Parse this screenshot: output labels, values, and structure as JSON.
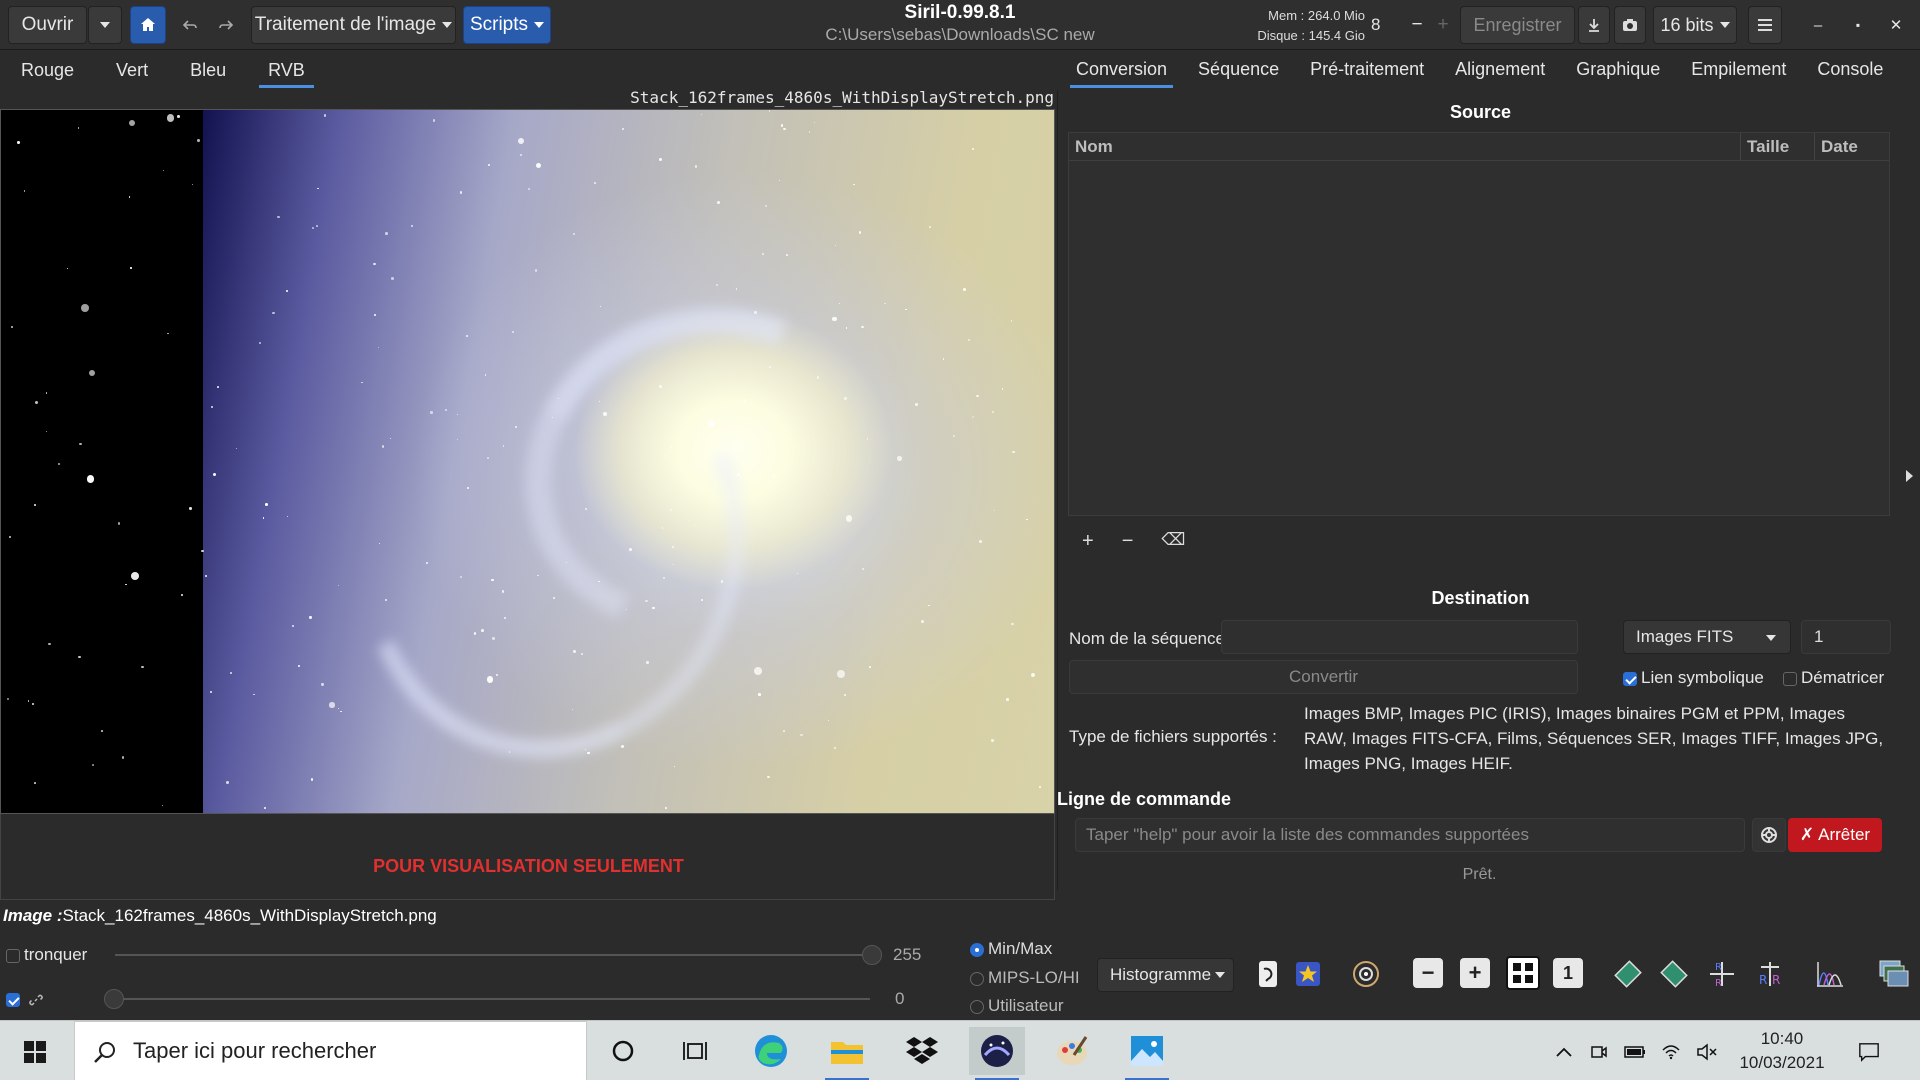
{
  "header": {
    "open_label": "Ouvrir",
    "processing_label": "Traitement de l'image",
    "scripts_label": "Scripts",
    "app_title": "Siril-0.99.8.1",
    "working_dir": "C:\\Users\\sebas\\Downloads\\SC new",
    "mem_label": "Mem : 264.0 Mio",
    "disk_label": "Disque : 145.4 Gio",
    "threads_value": "8",
    "minus_label": "−",
    "plus_label": "+",
    "save_label": "Enregistrer",
    "bitdepth_label": "16 bits",
    "minimize_label": "–",
    "maximize_label": "▪",
    "close_label": "✕"
  },
  "channel_tabs": [
    "Rouge",
    "Vert",
    "Bleu",
    "RVB"
  ],
  "active_channel": "RVB",
  "image": {
    "filename": "Stack_162frames_4860s_WithDisplayStretch.png",
    "preview_notice": "POUR VISUALISATION SEULEMENT"
  },
  "right_tabs": [
    "Conversion",
    "Séquence",
    "Pré-traitement",
    "Alignement",
    "Graphique",
    "Empilement",
    "Console"
  ],
  "active_right_tab": "Conversion",
  "conversion": {
    "source_title": "Source",
    "columns": [
      "Nom",
      "Taille",
      "Date"
    ],
    "add_label": "+",
    "remove_label": "−",
    "clear_label": "⌫",
    "destination_title": "Destination",
    "sequence_name_label": "Nom de la séquence :",
    "sequence_name_value": "",
    "output_type": "Images FITS",
    "start_index": "1",
    "convert_label": "Convertir",
    "symlink_label": "Lien symbolique",
    "symlink_checked": true,
    "debayer_label": "Dématricer",
    "debayer_checked": false,
    "supported_label": "Type de fichiers supportés :",
    "supported_value": "Images BMP, Images PIC (IRIS), Images binaires PGM et PPM, Images RAW, Images FITS-CFA, Films, Séquences SER, Images TIFF, Images JPG, Images PNG, Images HEIF."
  },
  "command": {
    "title": "Ligne de commande",
    "placeholder": "Taper \"help\" pour avoir la liste des commandes supportées",
    "stop_label": "Arrêter",
    "status": "Prêt."
  },
  "bottom": {
    "image_prefix": "Image :",
    "image_name": "Stack_162frames_4860s_WithDisplayStretch.png",
    "clip_label": "tronquer",
    "high_value": "255",
    "low_value": "0",
    "link_checked": true,
    "scale_options": [
      "Min/Max",
      "MIPS-LO/HI",
      "Utilisateur"
    ],
    "scale_selected": "Min/Max",
    "display_mode": "Histogramme"
  },
  "taskbar": {
    "search_placeholder": "Taper ici pour rechercher",
    "time": "10:40",
    "date": "10/03/2021"
  },
  "colors": {
    "accent": "#4a8fe0",
    "header_blue": "#2a5cae",
    "stop_red": "#c0181e",
    "notice_red": "#e03030"
  }
}
